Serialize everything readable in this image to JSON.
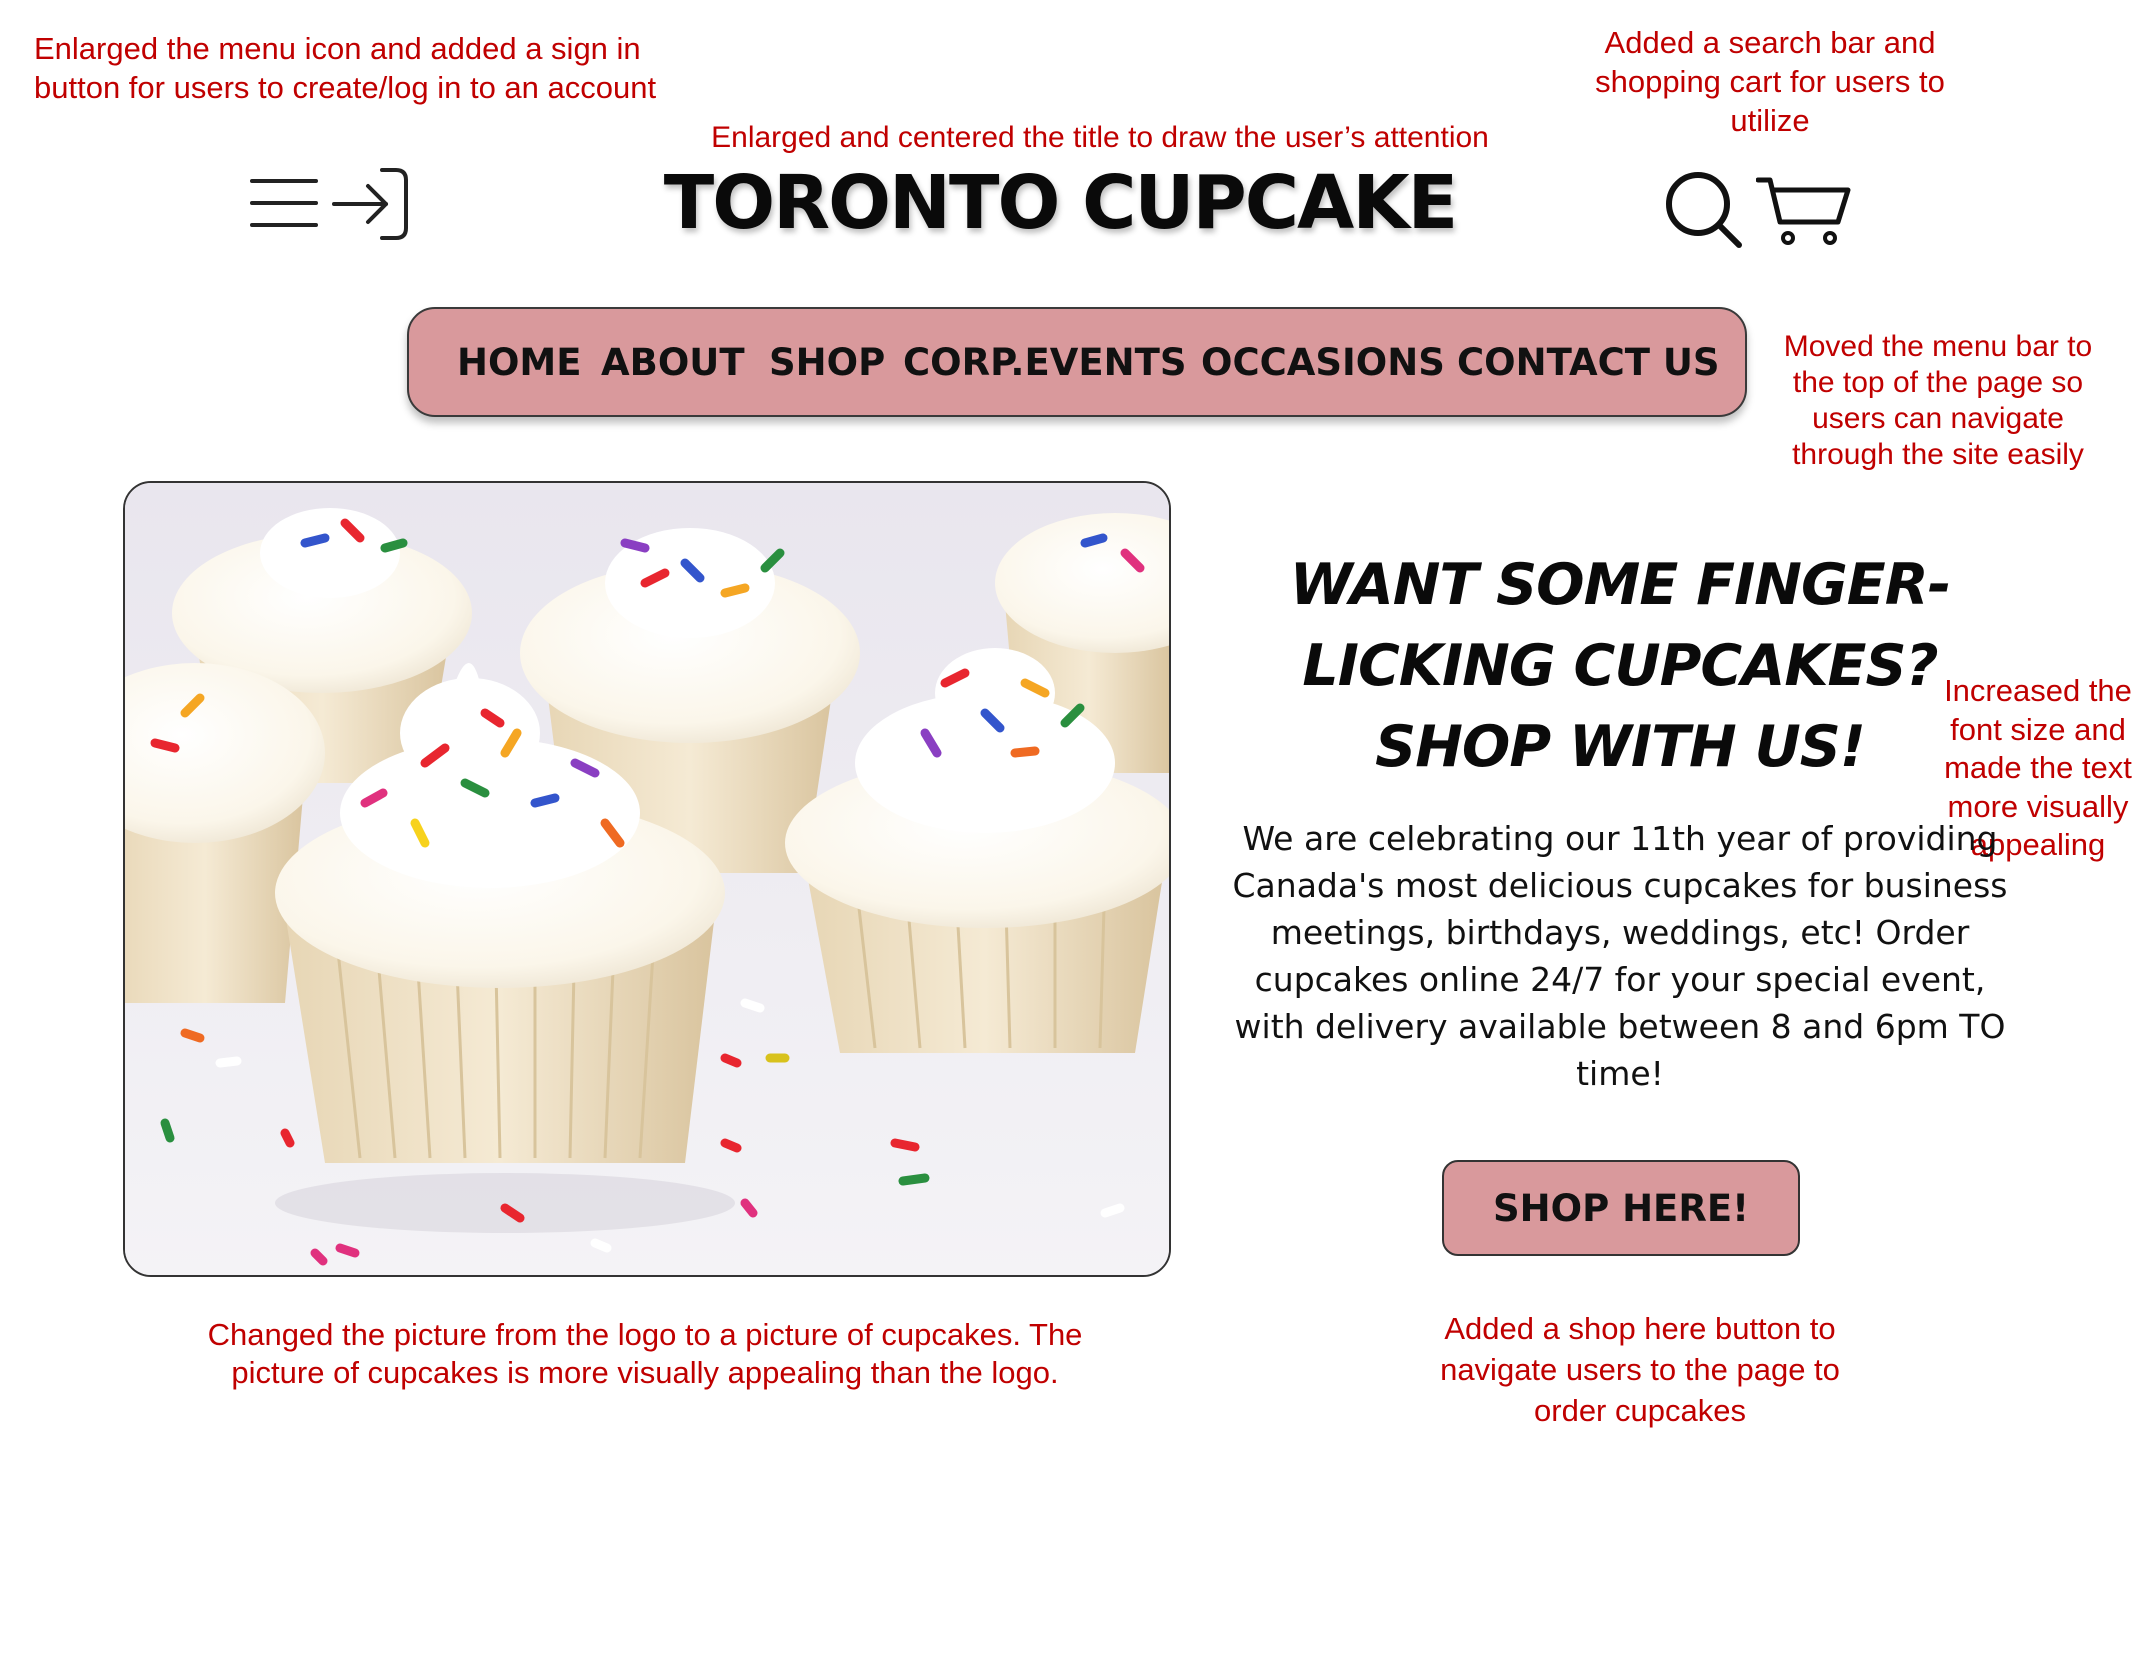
{
  "annotations": {
    "menu_signin": "Enlarged the menu icon and added a sign in button for users to create/log in to an account",
    "title": "Enlarged and centered the title to draw the user’s attention",
    "search_cart": "Added a search bar and shopping cart for users to utilize",
    "menu_bar": "Moved the menu bar to the top of the page so users can navigate through the site easily",
    "font_size": "Increased the font size and made the text more visually appealing",
    "picture": "Changed the picture from the logo to a picture of cupcakes. The picture of cupcakes is more visually appealing than the logo.",
    "shop_button": "Added a shop here button to navigate users to the page to order cupcakes"
  },
  "header": {
    "title": "TORONTO CUPCAKE",
    "icons": [
      "menu-icon",
      "sign-in-icon",
      "search-icon",
      "cart-icon"
    ]
  },
  "nav": {
    "items": [
      "HOME",
      "ABOUT",
      "SHOP",
      "CORP.EVENTS",
      "OCCASIONS",
      "CONTACT US"
    ]
  },
  "hero": {
    "headline": "WANT SOME FINGER-LICKING CUPCAKES? SHOP WITH US!",
    "body": "We are celebrating our 11th year of providing Canada's most delicious cupcakes for business meetings, birthdays, weddings, etc! Order cupcakes online 24/7 for your special event, with delivery available between 8 and 6pm TO time!",
    "button_label": "SHOP HERE!"
  },
  "colors": {
    "accent": "#d9999c",
    "annotation": "#c00000"
  }
}
